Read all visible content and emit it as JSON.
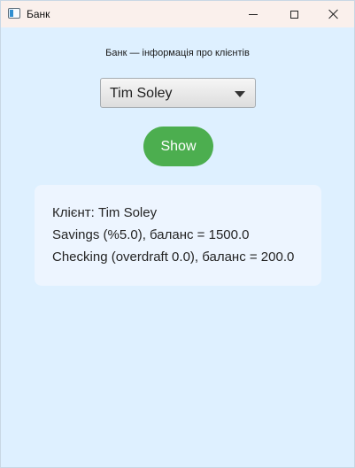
{
  "window": {
    "title": "Банк",
    "icon": "app-window-icon",
    "controls": {
      "minimize_icon": "minimize-icon",
      "maximize_icon": "maximize-icon",
      "close_icon": "close-icon"
    }
  },
  "main": {
    "heading": "Банк — інформація про клієнтів",
    "client_select": {
      "selected_value": "Tim Soley",
      "arrow_icon": "chevron-down-icon"
    },
    "show_button": {
      "label": "Show",
      "color": "#4cae4f"
    },
    "info": {
      "client_line": "Клієнт: Tim Soley",
      "savings_line": "Savings (%5.0), баланс = 1500.0",
      "checking_line": "Checking (overdraft 0.0), баланс = 200.0"
    }
  }
}
